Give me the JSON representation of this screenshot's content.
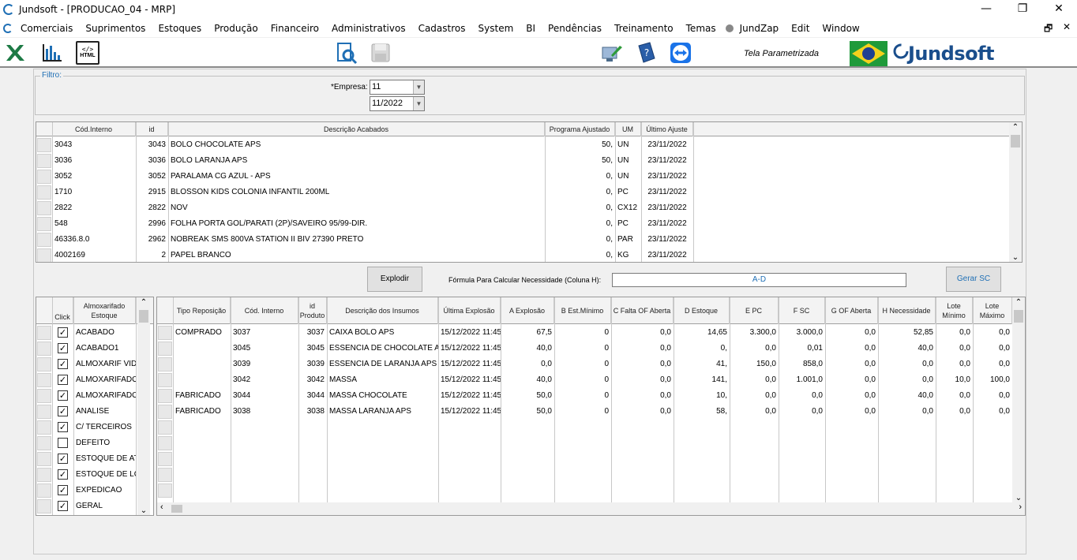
{
  "window": {
    "title": "Jundsoft - [PRODUCAO_04 -  MRP]",
    "minimize": "—",
    "maximize": "❐",
    "close": "✕"
  },
  "menu": [
    "Comerciais",
    "Suprimentos",
    "Estoques",
    "Produção",
    "Financeiro",
    "Administrativos",
    "Cadastros",
    "System",
    "BI",
    "Pendências",
    "Treinamento",
    "Temas",
    "JundZap",
    "Edit",
    "Window"
  ],
  "mdi": {
    "restore": "🗗",
    "close": "✕"
  },
  "toolbar": {
    "html_label": "HTML",
    "tela_label": "Tela Parametrizada",
    "brand": "Jundsoft"
  },
  "colors": {
    "accent": "#1f6fb5",
    "brand": "#1a4e8c",
    "excel": "#1d7a45",
    "flag_green": "#1f9a3a",
    "flag_yellow": "#f3d11c",
    "flag_blue": "#1e3f91"
  },
  "filtro": {
    "legend": "Filtro:",
    "empresa_label": "*Empresa:",
    "empresa_value": "11",
    "periodo_value": "11/2022"
  },
  "acabados": {
    "headers": [
      "Cód.Interno",
      "id",
      "Descrição Acabados",
      "Programa Ajustado",
      "UM",
      "Último Ajuste"
    ],
    "rows": [
      [
        "3043",
        "3043",
        "BOLO CHOCOLATE APS",
        "50,",
        "UN",
        "23/11/2022"
      ],
      [
        "3036",
        "3036",
        "BOLO LARANJA APS",
        "50,",
        "UN",
        "23/11/2022"
      ],
      [
        "3052",
        "3052",
        "PARALAMA CG AZUL - APS",
        "0,",
        "UN",
        "23/11/2022"
      ],
      [
        "1710",
        "2915",
        "BLOSSON KIDS COLONIA INFANTIL 200ML",
        "0,",
        "PC",
        "23/11/2022"
      ],
      [
        "2822",
        "2822",
        "NOV",
        "0,",
        "CX12",
        "23/11/2022"
      ],
      [
        "548",
        "2996",
        "FOLHA PORTA GOL/PARATI (2P)/SAVEIRO 95/99-DIR.",
        "0,",
        "PC",
        "23/11/2022"
      ],
      [
        "46336.8.0",
        "2962",
        "NOBREAK SMS 800VA STATION II BIV 27390 PRETO",
        "0,",
        "PAR",
        "23/11/2022"
      ],
      [
        "4002169",
        "2",
        "PAPEL BRANCO",
        "0,",
        "KG",
        "23/11/2022"
      ]
    ]
  },
  "actions": {
    "explodir": "Explodir",
    "formula_label": "Fórmula Para Calcular Necessidade (Coluna H):",
    "formula_value": "A-D",
    "gerar_sc": "Gerar SC"
  },
  "almox": {
    "headers": [
      "Click",
      "Almoxarifado Estoque"
    ],
    "rows": [
      {
        "checked": true,
        "name": "ACABADO"
      },
      {
        "checked": true,
        "name": "ACABADO1"
      },
      {
        "checked": true,
        "name": "ALMOXARIF VIDE"
      },
      {
        "checked": true,
        "name": "ALMOXARIFADO"
      },
      {
        "checked": true,
        "name": "ALMOXARIFADO"
      },
      {
        "checked": true,
        "name": "ANALISE"
      },
      {
        "checked": true,
        "name": "C/ TERCEIROS"
      },
      {
        "checked": false,
        "name": "DEFEITO"
      },
      {
        "checked": true,
        "name": "ESTOQUE DE AT"
      },
      {
        "checked": true,
        "name": "ESTOQUE DE LC"
      },
      {
        "checked": true,
        "name": "EXPEDICAO"
      },
      {
        "checked": true,
        "name": "GERAL"
      }
    ]
  },
  "insumos": {
    "headers": [
      "Tipo Reposição",
      "Cód. Interno",
      "id Produto",
      "Descrição dos Insumos",
      "Última Explosão",
      "A Explosão",
      "B Est.Mínimo",
      "C Falta OF Aberta",
      "D Estoque",
      "E PC",
      "F SC",
      "G OF Aberta",
      "H Necessidade",
      "Lote Mínimo",
      "Lote Máximo"
    ],
    "rows": [
      [
        "COMPRADO",
        "3037",
        "3037",
        "CAIXA BOLO APS",
        "15/12/2022 11:45",
        "67,5",
        "0",
        "0,0",
        "14,65",
        "3.300,0",
        "3.000,0",
        "0,0",
        "52,85",
        "0,0",
        "0,0"
      ],
      [
        "",
        "3045",
        "3045",
        "ESSENCIA DE CHOCOLATE APS",
        "15/12/2022 11:45",
        "40,0",
        "0",
        "0,0",
        "0,",
        "0,0",
        "0,01",
        "0,0",
        "40,0",
        "0,0",
        "0,0"
      ],
      [
        "",
        "3039",
        "3039",
        "ESSENCIA DE LARANJA APS",
        "15/12/2022 11:45",
        "0,0",
        "0",
        "0,0",
        "41,",
        "150,0",
        "858,0",
        "0,0",
        "0,0",
        "0,0",
        "0,0"
      ],
      [
        "",
        "3042",
        "3042",
        "MASSA",
        "15/12/2022 11:45",
        "40,0",
        "0",
        "0,0",
        "141,",
        "0,0",
        "1.001,0",
        "0,0",
        "0,0",
        "10,0",
        "100,0"
      ],
      [
        "FABRICADO",
        "3044",
        "3044",
        "MASSA CHOCOLATE",
        "15/12/2022 11:45",
        "50,0",
        "0",
        "0,0",
        "10,",
        "0,0",
        "0,0",
        "0,0",
        "40,0",
        "0,0",
        "0,0"
      ],
      [
        "FABRICADO",
        "3038",
        "3038",
        "MASSA LARANJA APS",
        "15/12/2022 11:45",
        "50,0",
        "0",
        "0,0",
        "58,",
        "0,0",
        "0,0",
        "0,0",
        "0,0",
        "0,0",
        "0,0"
      ]
    ]
  }
}
